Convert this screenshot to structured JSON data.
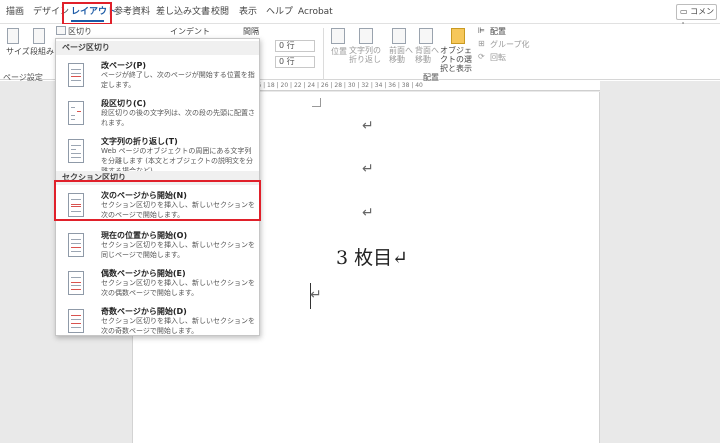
{
  "tabs": [
    {
      "label": "描画"
    },
    {
      "label": "デザイン"
    },
    {
      "label": "レイアウト"
    },
    {
      "label": "参考資料"
    },
    {
      "label": "差し込み文書"
    },
    {
      "label": "校閲"
    },
    {
      "label": "表示"
    },
    {
      "label": "ヘルプ"
    },
    {
      "label": "Acrobat"
    }
  ],
  "comment_button": "コメント",
  "ribbon": {
    "size_label": "サイズ",
    "columns_label": "段組み",
    "breaks_label": "区切り",
    "page_setup_label": "ページ設定",
    "indent_label": "インデント",
    "spacing_label": "間隔",
    "spacing_before": "0 行",
    "spacing_after": "0 行",
    "position_label": "位置",
    "wrap_label": "文字列の折り返し",
    "forward_label": "前面へ移動",
    "backward_label": "背面へ移動",
    "selection_label": "オブジェクトの選択と表示",
    "align_label": "配置",
    "group_label": "グループ化",
    "rotate_label": "回転",
    "arrange_label": "配置"
  },
  "dropdown": {
    "page_breaks_header": "ページ区切り",
    "section_breaks_header": "セクション区切り",
    "items": [
      {
        "title": "改ページ(P)",
        "desc": "ページが終了し、次のページが開始する位置を指定します。"
      },
      {
        "title": "段区切り(C)",
        "desc": "段区切りの後の文字列は、次の段の先頭に配置されます。"
      },
      {
        "title": "文字列の折り返し(T)",
        "desc": "Web ページのオブジェクトの周囲にある文字列を分離します (本文とオブジェクトの説明文を分離する場合など)。"
      },
      {
        "title": "次のページから開始(N)",
        "desc": "セクション区切りを挿入し、新しいセクションを次のページで開始します。"
      },
      {
        "title": "現在の位置から開始(O)",
        "desc": "セクション区切りを挿入し、新しいセクションを同じページで開始します。"
      },
      {
        "title": "偶数ページから開始(E)",
        "desc": "セクション区切りを挿入し、新しいセクションを次の偶数ページで開始します。"
      },
      {
        "title": "奇数ページから開始(D)",
        "desc": "セクション区切りを挿入し、新しいセクションを次の奇数ページで開始します。"
      }
    ]
  },
  "ruler_text": "8  |  6  |  4  |  2  |     |  2  |  4  |  6  |  8  |  10  |  12  |  14  |  16  |  18  |  20  |  22  |  24  |  26  |  28  |  30  |  32  |  34  |  36  |  38  |  40",
  "document": {
    "paragraph_mark": "↵",
    "body_text": "3 枚目↵"
  },
  "colors": {
    "accent": "#1b5aa6",
    "highlight": "#e0202a"
  }
}
